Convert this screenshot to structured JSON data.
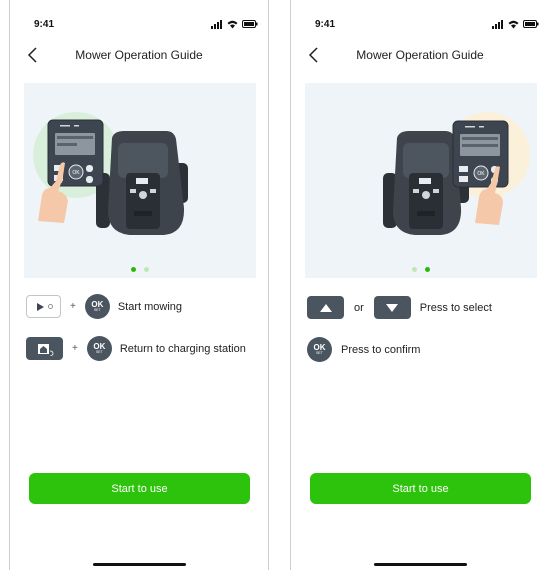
{
  "colors": {
    "accent_green": "#2dc20c",
    "button_dark": "#4a5560"
  },
  "left": {
    "status_time": "9:41",
    "title": "Mower Operation Guide",
    "page_index": 1,
    "rows": [
      {
        "label": "Start mowing",
        "ok_big": "OK",
        "ok_small": "SET"
      },
      {
        "label": "Return to charging station",
        "ok_big": "OK",
        "ok_small": "SET"
      }
    ],
    "plus": "+",
    "start_button": "Start to use"
  },
  "right": {
    "status_time": "9:41",
    "title": "Mower Operation Guide",
    "page_index": 2,
    "or_text": "or",
    "select_label": "Press to select",
    "confirm_label": "Press to confirm",
    "ok_big": "OK",
    "ok_small": "SET",
    "start_button": "Start to use"
  }
}
